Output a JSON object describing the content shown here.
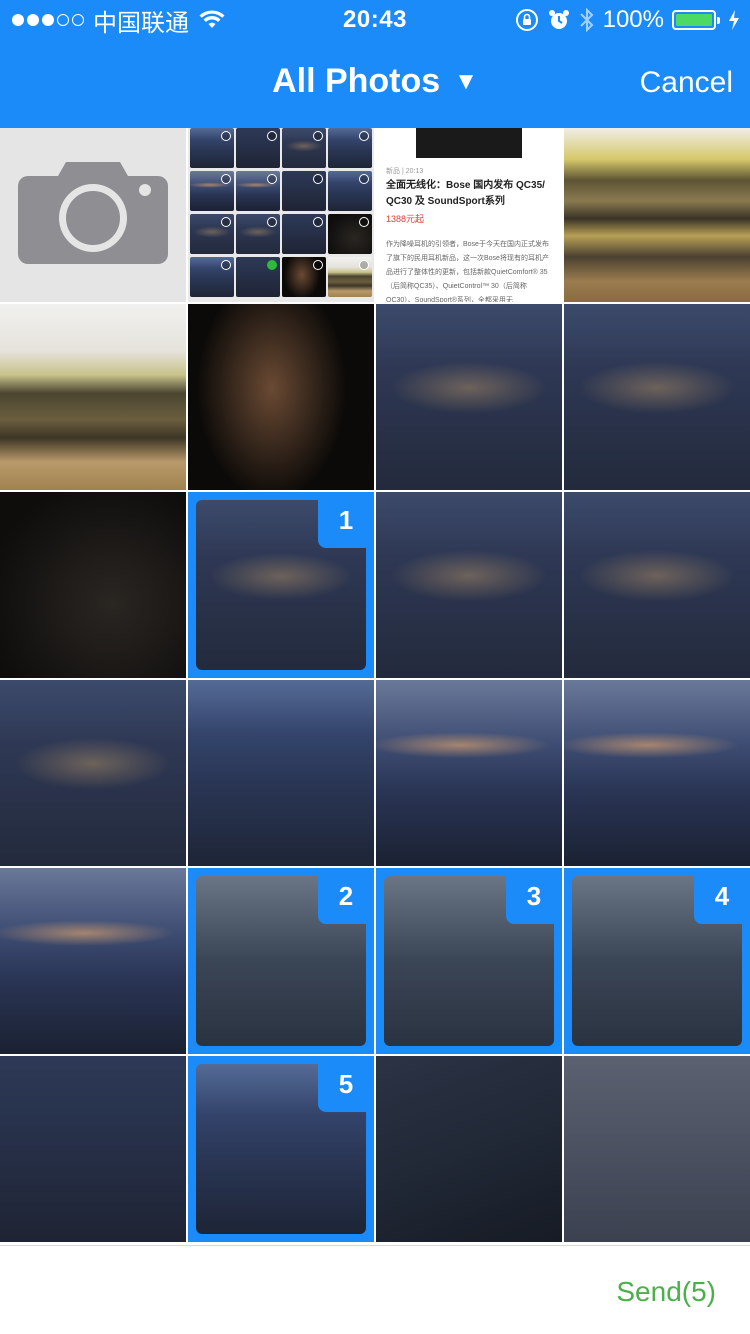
{
  "status_bar": {
    "carrier": "中国联通",
    "time": "20:43",
    "battery": "100%",
    "colors": {
      "battery_fill": "#4cd964"
    }
  },
  "nav": {
    "title": "All Photos",
    "caret": "▼",
    "cancel_label": "Cancel",
    "background": "#1b8bf9"
  },
  "grid": {
    "selected_badges": [
      "1",
      "2",
      "3",
      "4",
      "5"
    ],
    "accent": "#1b8bf9"
  },
  "article_thumb": {
    "meta": "新品 | 20:13",
    "title": "全面无线化：Bose 国内发布 QC35/ QC30 及 SoundSport系列",
    "price": "1388元起",
    "body": "作为降噪耳机的引领者，Bose于今天在国内正式发布了旗下的民用耳机新品，这一次Bose将现有的耳机产品进行了整体性的更新，包括新款QuietComfort® 35（后简称QC35）、QuietControl™ 30（后简称QC30）、SoundSport®系列，全都采用无"
  },
  "bottom": {
    "send_label": "Send(5)",
    "send_color": "#4cb04a"
  },
  "icons": [
    "camera-icon",
    "wifi-icon",
    "lock-rotation-icon",
    "alarm-icon",
    "bluetooth-icon",
    "battery-icon",
    "charging-icon",
    "dropdown-caret-icon"
  ]
}
